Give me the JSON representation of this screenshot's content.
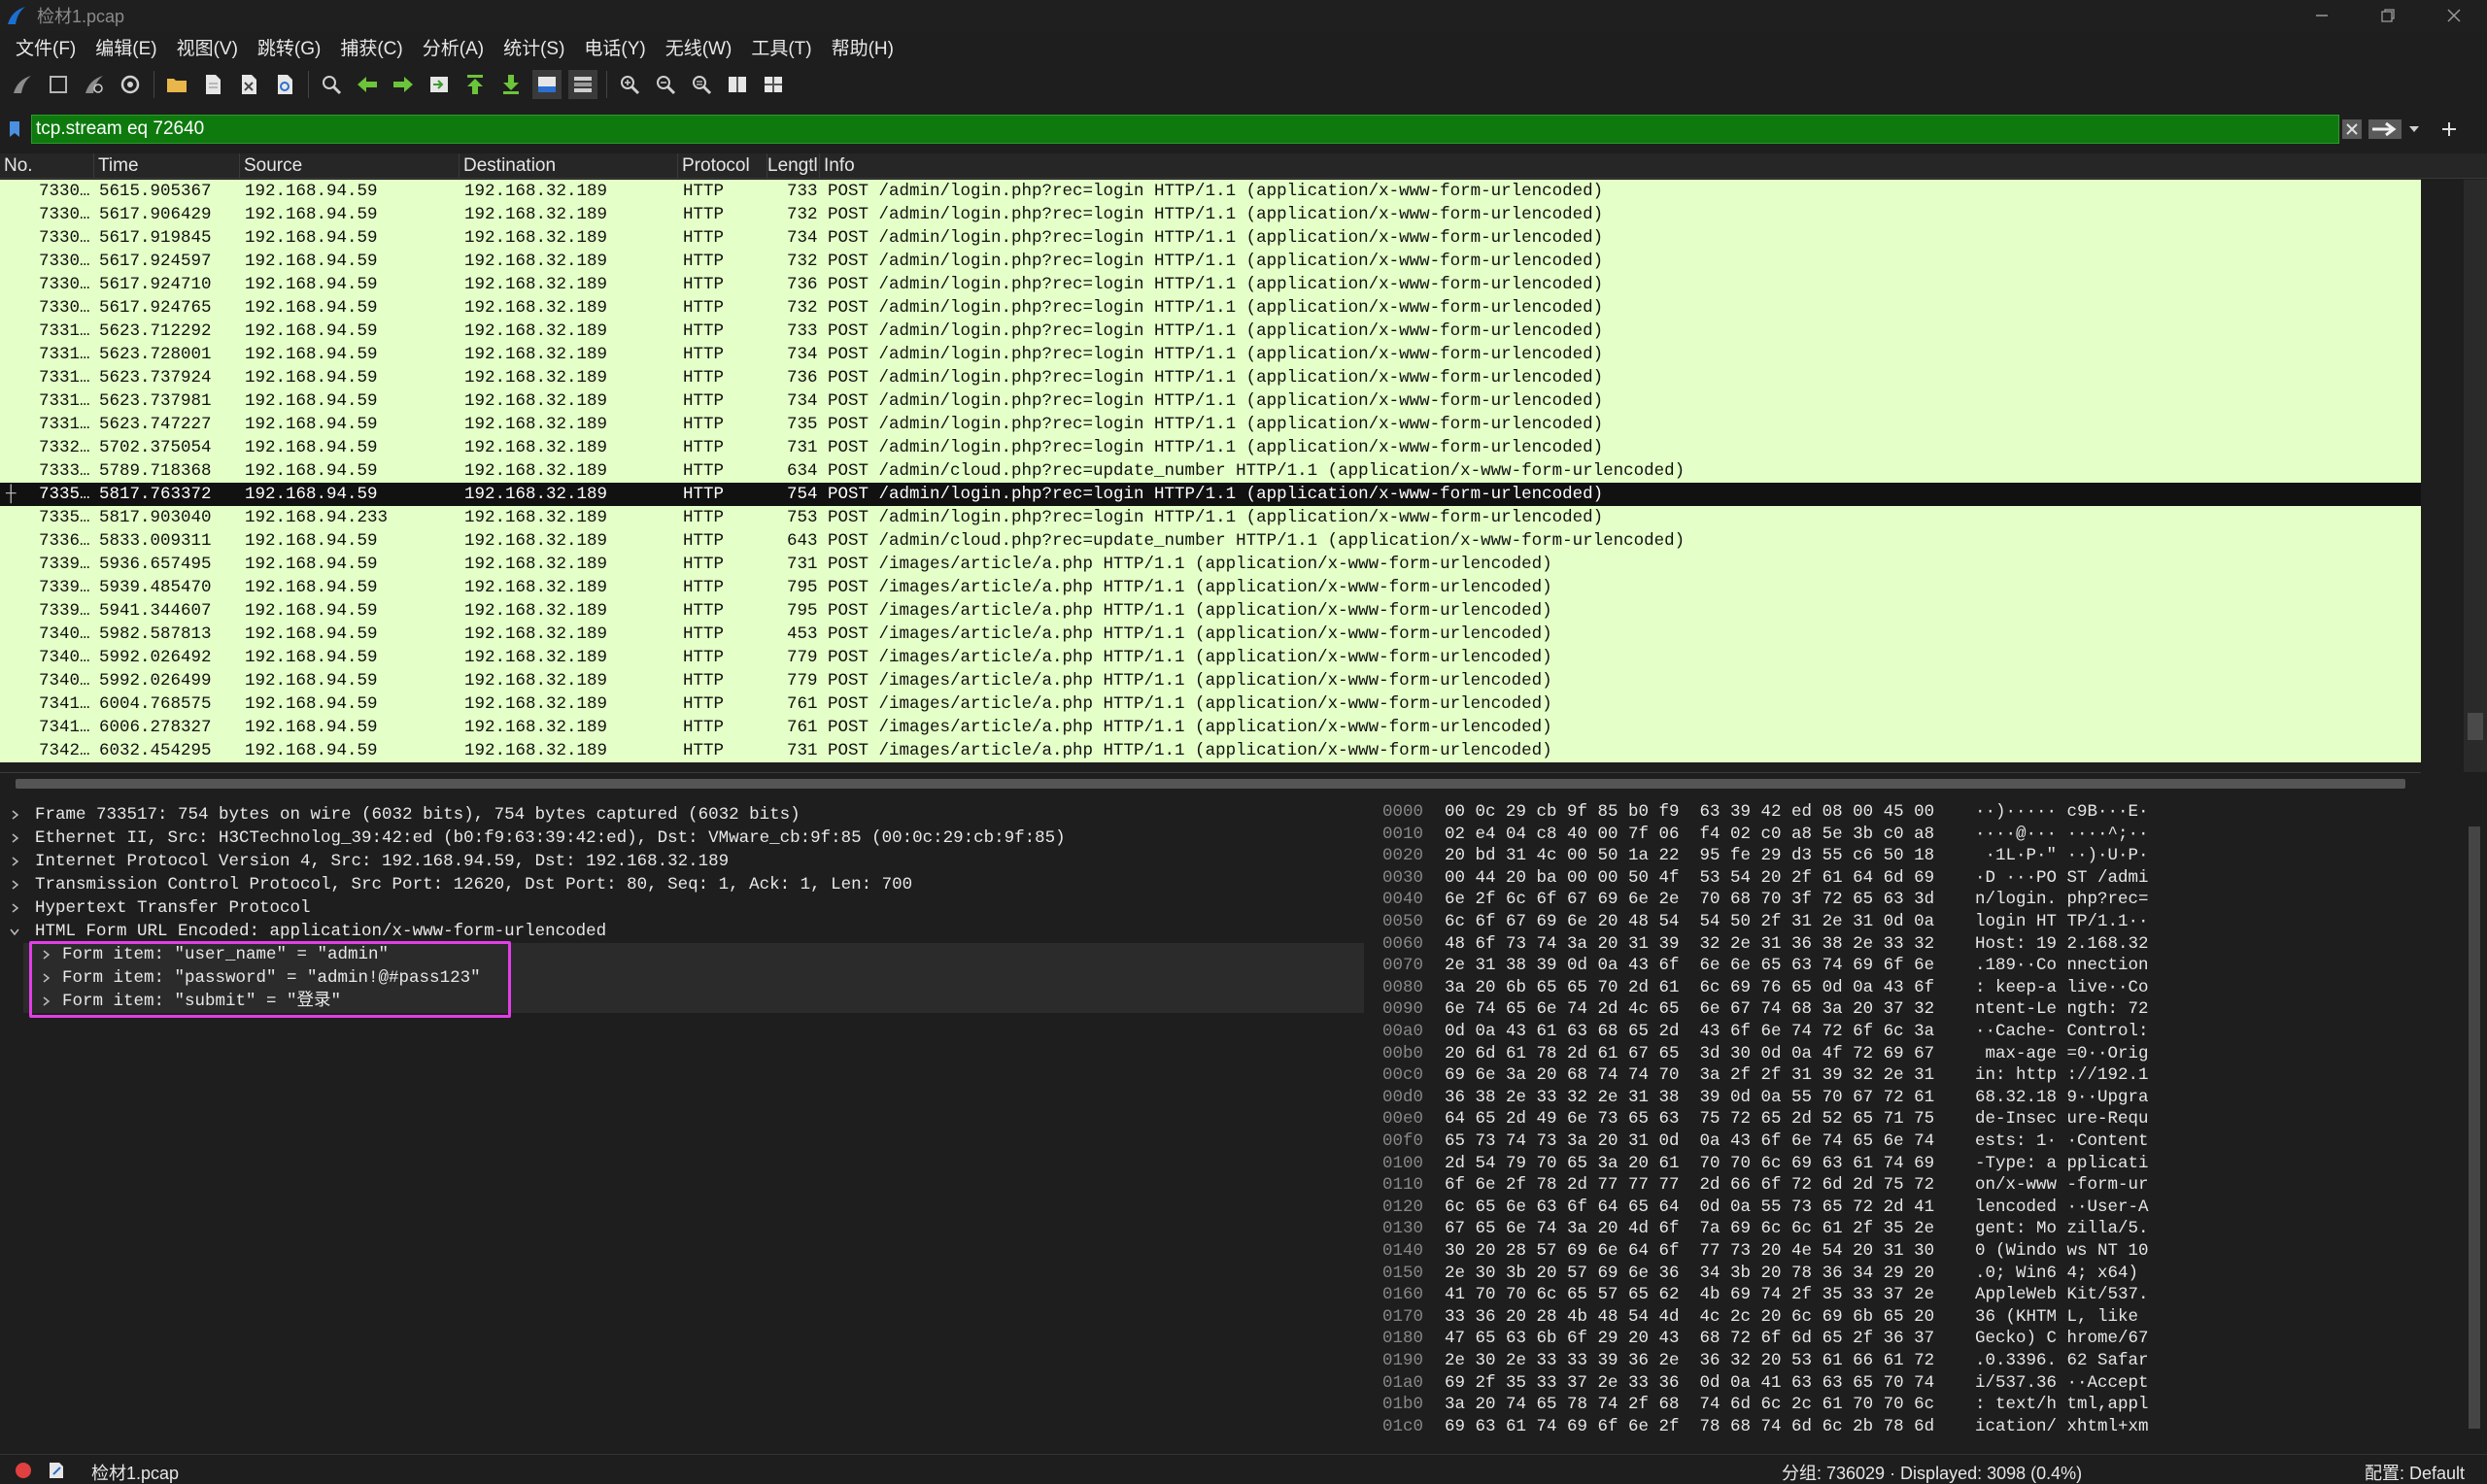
{
  "window": {
    "title": "检材1.pcap"
  },
  "menu": [
    "文件(F)",
    "编辑(E)",
    "视图(V)",
    "跳转(G)",
    "捕获(C)",
    "分析(A)",
    "统计(S)",
    "电话(Y)",
    "无线(W)",
    "工具(T)",
    "帮助(H)"
  ],
  "filter": {
    "value": "tcp.stream eq 72640"
  },
  "columns": [
    "No.",
    "Time",
    "Source",
    "Destination",
    "Protocol",
    "Lengtl",
    "Info"
  ],
  "packets": [
    {
      "no": "7330…",
      "time": "5615.905367",
      "src": "192.168.94.59",
      "dst": "192.168.32.189",
      "proto": "HTTP",
      "len": "733",
      "info": "POST /admin/login.php?rec=login HTTP/1.1  (application/x-www-form-urlencoded)"
    },
    {
      "no": "7330…",
      "time": "5617.906429",
      "src": "192.168.94.59",
      "dst": "192.168.32.189",
      "proto": "HTTP",
      "len": "732",
      "info": "POST /admin/login.php?rec=login HTTP/1.1  (application/x-www-form-urlencoded)"
    },
    {
      "no": "7330…",
      "time": "5617.919845",
      "src": "192.168.94.59",
      "dst": "192.168.32.189",
      "proto": "HTTP",
      "len": "734",
      "info": "POST /admin/login.php?rec=login HTTP/1.1  (application/x-www-form-urlencoded)"
    },
    {
      "no": "7330…",
      "time": "5617.924597",
      "src": "192.168.94.59",
      "dst": "192.168.32.189",
      "proto": "HTTP",
      "len": "732",
      "info": "POST /admin/login.php?rec=login HTTP/1.1  (application/x-www-form-urlencoded)"
    },
    {
      "no": "7330…",
      "time": "5617.924710",
      "src": "192.168.94.59",
      "dst": "192.168.32.189",
      "proto": "HTTP",
      "len": "736",
      "info": "POST /admin/login.php?rec=login HTTP/1.1  (application/x-www-form-urlencoded)"
    },
    {
      "no": "7330…",
      "time": "5617.924765",
      "src": "192.168.94.59",
      "dst": "192.168.32.189",
      "proto": "HTTP",
      "len": "732",
      "info": "POST /admin/login.php?rec=login HTTP/1.1  (application/x-www-form-urlencoded)"
    },
    {
      "no": "7331…",
      "time": "5623.712292",
      "src": "192.168.94.59",
      "dst": "192.168.32.189",
      "proto": "HTTP",
      "len": "733",
      "info": "POST /admin/login.php?rec=login HTTP/1.1  (application/x-www-form-urlencoded)"
    },
    {
      "no": "7331…",
      "time": "5623.728001",
      "src": "192.168.94.59",
      "dst": "192.168.32.189",
      "proto": "HTTP",
      "len": "734",
      "info": "POST /admin/login.php?rec=login HTTP/1.1  (application/x-www-form-urlencoded)"
    },
    {
      "no": "7331…",
      "time": "5623.737924",
      "src": "192.168.94.59",
      "dst": "192.168.32.189",
      "proto": "HTTP",
      "len": "736",
      "info": "POST /admin/login.php?rec=login HTTP/1.1  (application/x-www-form-urlencoded)"
    },
    {
      "no": "7331…",
      "time": "5623.737981",
      "src": "192.168.94.59",
      "dst": "192.168.32.189",
      "proto": "HTTP",
      "len": "734",
      "info": "POST /admin/login.php?rec=login HTTP/1.1  (application/x-www-form-urlencoded)"
    },
    {
      "no": "7331…",
      "time": "5623.747227",
      "src": "192.168.94.59",
      "dst": "192.168.32.189",
      "proto": "HTTP",
      "len": "735",
      "info": "POST /admin/login.php?rec=login HTTP/1.1  (application/x-www-form-urlencoded)"
    },
    {
      "no": "7332…",
      "time": "5702.375054",
      "src": "192.168.94.59",
      "dst": "192.168.32.189",
      "proto": "HTTP",
      "len": "731",
      "info": "POST /admin/login.php?rec=login HTTP/1.1  (application/x-www-form-urlencoded)"
    },
    {
      "no": "7333…",
      "time": "5789.718368",
      "src": "192.168.94.59",
      "dst": "192.168.32.189",
      "proto": "HTTP",
      "len": "634",
      "info": "POST /admin/cloud.php?rec=update_number HTTP/1.1  (application/x-www-form-urlencoded)"
    },
    {
      "no": "7335…",
      "time": "5817.763372",
      "src": "192.168.94.59",
      "dst": "192.168.32.189",
      "proto": "HTTP",
      "len": "754",
      "info": "POST /admin/login.php?rec=login HTTP/1.1  (application/x-www-form-urlencoded)",
      "selected": true
    },
    {
      "no": "7335…",
      "time": "5817.903040",
      "src": "192.168.94.233",
      "dst": "192.168.32.189",
      "proto": "HTTP",
      "len": "753",
      "info": "POST /admin/login.php?rec=login HTTP/1.1  (application/x-www-form-urlencoded)"
    },
    {
      "no": "7336…",
      "time": "5833.009311",
      "src": "192.168.94.59",
      "dst": "192.168.32.189",
      "proto": "HTTP",
      "len": "643",
      "info": "POST /admin/cloud.php?rec=update_number HTTP/1.1  (application/x-www-form-urlencoded)"
    },
    {
      "no": "7339…",
      "time": "5936.657495",
      "src": "192.168.94.59",
      "dst": "192.168.32.189",
      "proto": "HTTP",
      "len": "731",
      "info": "POST /images/article/a.php HTTP/1.1  (application/x-www-form-urlencoded)"
    },
    {
      "no": "7339…",
      "time": "5939.485470",
      "src": "192.168.94.59",
      "dst": "192.168.32.189",
      "proto": "HTTP",
      "len": "795",
      "info": "POST /images/article/a.php HTTP/1.1  (application/x-www-form-urlencoded)"
    },
    {
      "no": "7339…",
      "time": "5941.344607",
      "src": "192.168.94.59",
      "dst": "192.168.32.189",
      "proto": "HTTP",
      "len": "795",
      "info": "POST /images/article/a.php HTTP/1.1  (application/x-www-form-urlencoded)"
    },
    {
      "no": "7340…",
      "time": "5982.587813",
      "src": "192.168.94.59",
      "dst": "192.168.32.189",
      "proto": "HTTP",
      "len": "453",
      "info": "POST /images/article/a.php HTTP/1.1  (application/x-www-form-urlencoded)"
    },
    {
      "no": "7340…",
      "time": "5992.026492",
      "src": "192.168.94.59",
      "dst": "192.168.32.189",
      "proto": "HTTP",
      "len": "779",
      "info": "POST /images/article/a.php HTTP/1.1  (application/x-www-form-urlencoded)"
    },
    {
      "no": "7340…",
      "time": "5992.026499",
      "src": "192.168.94.59",
      "dst": "192.168.32.189",
      "proto": "HTTP",
      "len": "779",
      "info": "POST /images/article/a.php HTTP/1.1  (application/x-www-form-urlencoded)"
    },
    {
      "no": "7341…",
      "time": "6004.768575",
      "src": "192.168.94.59",
      "dst": "192.168.32.189",
      "proto": "HTTP",
      "len": "761",
      "info": "POST /images/article/a.php HTTP/1.1  (application/x-www-form-urlencoded)"
    },
    {
      "no": "7341…",
      "time": "6006.278327",
      "src": "192.168.94.59",
      "dst": "192.168.32.189",
      "proto": "HTTP",
      "len": "761",
      "info": "POST /images/article/a.php HTTP/1.1  (application/x-www-form-urlencoded)"
    },
    {
      "no": "7342…",
      "time": "6032.454295",
      "src": "192.168.94.59",
      "dst": "192.168.32.189",
      "proto": "HTTP",
      "len": "731",
      "info": "POST /images/article/a.php HTTP/1.1  (application/x-www-form-urlencoded)"
    }
  ],
  "details": [
    {
      "text": "Frame 733517: 754 bytes on wire (6032 bits), 754 bytes captured (6032 bits)",
      "expanded": false,
      "level": 0
    },
    {
      "text": "Ethernet II, Src: H3CTechnolog_39:42:ed (b0:f9:63:39:42:ed), Dst: VMware_cb:9f:85 (00:0c:29:cb:9f:85)",
      "expanded": false,
      "level": 0
    },
    {
      "text": "Internet Protocol Version 4, Src: 192.168.94.59, Dst: 192.168.32.189",
      "expanded": false,
      "level": 0
    },
    {
      "text": "Transmission Control Protocol, Src Port: 12620, Dst Port: 80, Seq: 1, Ack: 1, Len: 700",
      "expanded": false,
      "level": 0
    },
    {
      "text": "Hypertext Transfer Protocol",
      "expanded": false,
      "level": 0
    },
    {
      "text": "HTML Form URL Encoded: application/x-www-form-urlencoded",
      "expanded": true,
      "level": 0
    },
    {
      "text": "Form item: \"user_name\" = \"admin\"",
      "expanded": false,
      "level": 1
    },
    {
      "text": "Form item: \"password\" = \"admin!@#pass123\"",
      "expanded": false,
      "level": 1
    },
    {
      "text": "Form item: \"submit\" = \"登录\"",
      "expanded": false,
      "level": 1
    }
  ],
  "hex": [
    {
      "off": "0000",
      "hex": "00 0c 29 cb 9f 85 b0 f9  63 39 42 ed 08 00 45 00",
      "ascii": "··)····· c9B···E·"
    },
    {
      "off": "0010",
      "hex": "02 e4 04 c8 40 00 7f 06  f4 02 c0 a8 5e 3b c0 a8",
      "ascii": "····@··· ····^;··"
    },
    {
      "off": "0020",
      "hex": "20 bd 31 4c 00 50 1a 22  95 fe 29 d3 55 c6 50 18",
      "ascii": " ·1L·P·\" ··)·U·P·"
    },
    {
      "off": "0030",
      "hex": "00 44 20 ba 00 00 50 4f  53 54 20 2f 61 64 6d 69",
      "ascii": "·D ···PO ST /admi"
    },
    {
      "off": "0040",
      "hex": "6e 2f 6c 6f 67 69 6e 2e  70 68 70 3f 72 65 63 3d",
      "ascii": "n/login. php?rec="
    },
    {
      "off": "0050",
      "hex": "6c 6f 67 69 6e 20 48 54  54 50 2f 31 2e 31 0d 0a",
      "ascii": "login HT TP/1.1··"
    },
    {
      "off": "0060",
      "hex": "48 6f 73 74 3a 20 31 39  32 2e 31 36 38 2e 33 32",
      "ascii": "Host: 19 2.168.32"
    },
    {
      "off": "0070",
      "hex": "2e 31 38 39 0d 0a 43 6f  6e 6e 65 63 74 69 6f 6e",
      "ascii": ".189··Co nnection"
    },
    {
      "off": "0080",
      "hex": "3a 20 6b 65 65 70 2d 61  6c 69 76 65 0d 0a 43 6f",
      "ascii": ": keep-a live··Co"
    },
    {
      "off": "0090",
      "hex": "6e 74 65 6e 74 2d 4c 65  6e 67 74 68 3a 20 37 32",
      "ascii": "ntent-Le ngth: 72"
    },
    {
      "off": "00a0",
      "hex": "0d 0a 43 61 63 68 65 2d  43 6f 6e 74 72 6f 6c 3a",
      "ascii": "··Cache- Control:"
    },
    {
      "off": "00b0",
      "hex": "20 6d 61 78 2d 61 67 65  3d 30 0d 0a 4f 72 69 67",
      "ascii": " max-age =0··Orig"
    },
    {
      "off": "00c0",
      "hex": "69 6e 3a 20 68 74 74 70  3a 2f 2f 31 39 32 2e 31",
      "ascii": "in: http ://192.1"
    },
    {
      "off": "00d0",
      "hex": "36 38 2e 33 32 2e 31 38  39 0d 0a 55 70 67 72 61",
      "ascii": "68.32.18 9··Upgra"
    },
    {
      "off": "00e0",
      "hex": "64 65 2d 49 6e 73 65 63  75 72 65 2d 52 65 71 75",
      "ascii": "de-Insec ure-Requ"
    },
    {
      "off": "00f0",
      "hex": "65 73 74 73 3a 20 31 0d  0a 43 6f 6e 74 65 6e 74",
      "ascii": "ests: 1· ·Content"
    },
    {
      "off": "0100",
      "hex": "2d 54 79 70 65 3a 20 61  70 70 6c 69 63 61 74 69",
      "ascii": "-Type: a pplicati"
    },
    {
      "off": "0110",
      "hex": "6f 6e 2f 78 2d 77 77 77  2d 66 6f 72 6d 2d 75 72",
      "ascii": "on/x-www -form-ur"
    },
    {
      "off": "0120",
      "hex": "6c 65 6e 63 6f 64 65 64  0d 0a 55 73 65 72 2d 41",
      "ascii": "lencoded ··User-A"
    },
    {
      "off": "0130",
      "hex": "67 65 6e 74 3a 20 4d 6f  7a 69 6c 6c 61 2f 35 2e",
      "ascii": "gent: Mo zilla/5."
    },
    {
      "off": "0140",
      "hex": "30 20 28 57 69 6e 64 6f  77 73 20 4e 54 20 31 30",
      "ascii": "0 (Windo ws NT 10"
    },
    {
      "off": "0150",
      "hex": "2e 30 3b 20 57 69 6e 36  34 3b 20 78 36 34 29 20",
      "ascii": ".0; Win6 4; x64) "
    },
    {
      "off": "0160",
      "hex": "41 70 70 6c 65 57 65 62  4b 69 74 2f 35 33 37 2e",
      "ascii": "AppleWeb Kit/537."
    },
    {
      "off": "0170",
      "hex": "33 36 20 28 4b 48 54 4d  4c 2c 20 6c 69 6b 65 20",
      "ascii": "36 (KHTM L, like "
    },
    {
      "off": "0180",
      "hex": "47 65 63 6b 6f 29 20 43  68 72 6f 6d 65 2f 36 37",
      "ascii": "Gecko) C hrome/67"
    },
    {
      "off": "0190",
      "hex": "2e 30 2e 33 33 39 36 2e  36 32 20 53 61 66 61 72",
      "ascii": ".0.3396. 62 Safar"
    },
    {
      "off": "01a0",
      "hex": "69 2f 35 33 37 2e 33 36  0d 0a 41 63 63 65 70 74",
      "ascii": "i/537.36 ··Accept"
    },
    {
      "off": "01b0",
      "hex": "3a 20 74 65 78 74 2f 68  74 6d 6c 2c 61 70 70 6c",
      "ascii": ": text/h tml,appl"
    },
    {
      "off": "01c0",
      "hex": "69 63 61 74 69 6f 6e 2f  78 68 74 6d 6c 2b 78 6d",
      "ascii": "ication/ xhtml+xm"
    }
  ],
  "status": {
    "file": "检材1.pcap",
    "packets": "分组: 736029 · Displayed: 3098 (0.4%)",
    "profile": "配置: Default"
  },
  "colors": {
    "row_bg": "#e4ffc7",
    "selected_row_bg": "#111111",
    "filter_bg": "#0e7a0e",
    "highlight_box": "#e23ee6"
  }
}
